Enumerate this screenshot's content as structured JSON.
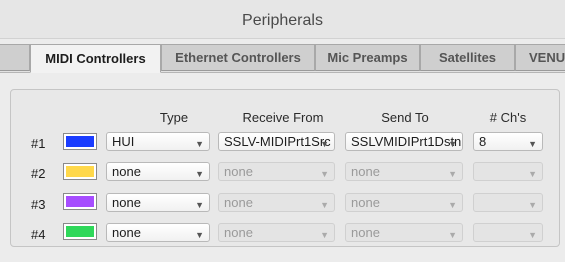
{
  "window": {
    "title": "Peripherals"
  },
  "tabs": [
    {
      "label": "",
      "active": false
    },
    {
      "label": "MIDI Controllers",
      "active": true
    },
    {
      "label": "Ethernet Controllers",
      "active": false
    },
    {
      "label": "Mic Preamps",
      "active": false
    },
    {
      "label": "Satellites",
      "active": false
    },
    {
      "label": "VENU",
      "active": false
    }
  ],
  "columns": {
    "type": "Type",
    "receive_from": "Receive From",
    "send_to": "Send To",
    "channels": "# Ch's"
  },
  "rows": [
    {
      "label": "#1",
      "color": "#1a3cff",
      "type": "HUI",
      "receive_from": "SSLV-MIDIPrt1Src",
      "send_to": "SSLVMIDIPrt1Dstn",
      "channels": "8",
      "enabled": true
    },
    {
      "label": "#2",
      "color": "#ffd84a",
      "type": "none",
      "receive_from": "none",
      "send_to": "none",
      "channels": "",
      "enabled": false
    },
    {
      "label": "#3",
      "color": "#a64dff",
      "type": "none",
      "receive_from": "none",
      "send_to": "none",
      "channels": "",
      "enabled": false
    },
    {
      "label": "#4",
      "color": "#2fd85a",
      "type": "none",
      "receive_from": "none",
      "send_to": "none",
      "channels": "",
      "enabled": false
    }
  ]
}
